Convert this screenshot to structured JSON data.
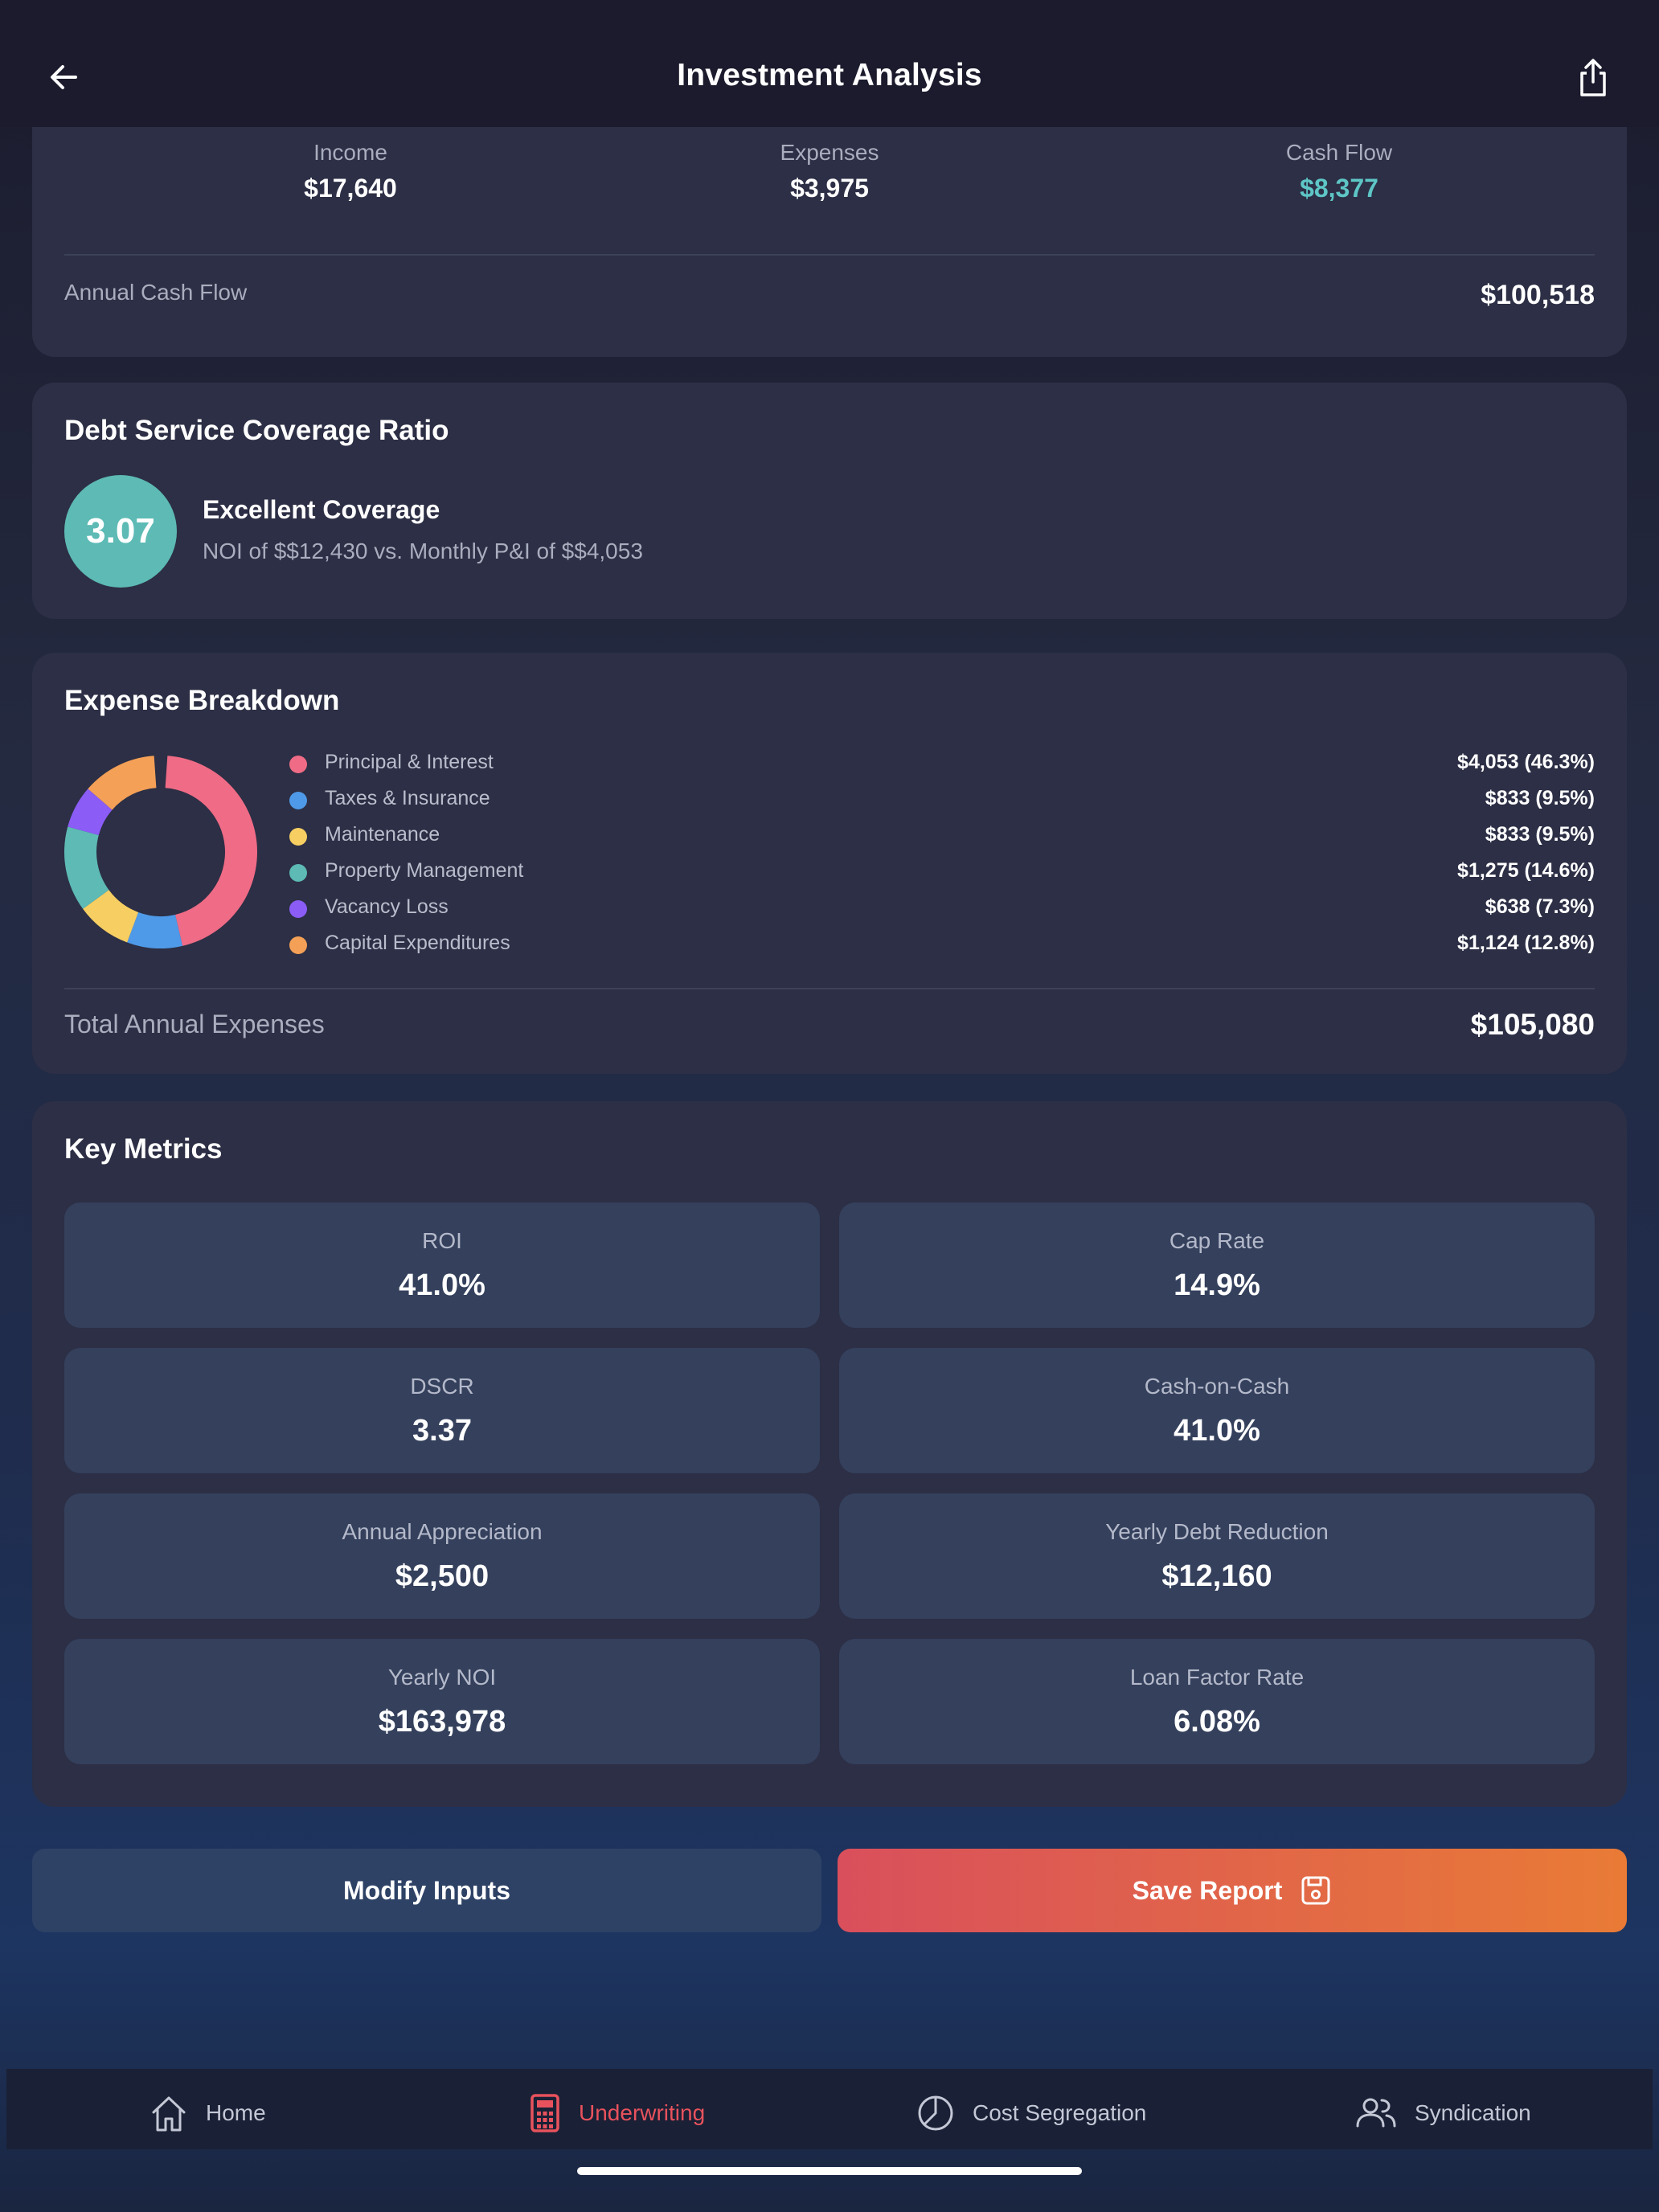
{
  "header": {
    "title": "Investment Analysis",
    "back_icon": "arrow-left-icon",
    "share_icon": "share-icon"
  },
  "monthly_summary": {
    "income_label": "Income",
    "income_value": "$17,640",
    "expenses_label": "Expenses",
    "expenses_value": "$3,975",
    "cashflow_label": "Cash Flow",
    "cashflow_value": "$8,377",
    "cashflow_color": "#5ec6c6",
    "annual_label": "Annual Cash Flow",
    "annual_value": "$100,518"
  },
  "dscr": {
    "title": "Debt Service Coverage Ratio",
    "value": "3.07",
    "status": "Excellent Coverage",
    "detail": "NOI of $$12,430 vs. Monthly P&I of $$4,053",
    "color": "#5dbab5"
  },
  "expense_breakdown": {
    "title": "Expense Breakdown",
    "total_label": "Total Annual Expenses",
    "total_value": "$105,080",
    "items": [
      {
        "label": "Principal & Interest",
        "value": "$4,053 (46.3%)",
        "color": "#f06b86"
      },
      {
        "label": "Taxes & Insurance",
        "value": "$833 (9.5%)",
        "color": "#4f9ae8"
      },
      {
        "label": "Maintenance",
        "value": "$833 (9.5%)",
        "color": "#f7ce62"
      },
      {
        "label": "Property Management",
        "value": "$1,275 (14.6%)",
        "color": "#5dbab5"
      },
      {
        "label": "Vacancy Loss",
        "value": "$638 (7.3%)",
        "color": "#8b5cf6"
      },
      {
        "label": "Capital Expenditures",
        "value": "$1,124 (12.8%)",
        "color": "#f4a056"
      }
    ]
  },
  "chart_data": {
    "type": "pie",
    "title": "Expense Breakdown",
    "categories": [
      "Principal & Interest",
      "Taxes & Insurance",
      "Maintenance",
      "Property Management",
      "Vacancy Loss",
      "Capital Expenditures"
    ],
    "values": [
      46.3,
      9.5,
      9.5,
      14.6,
      7.3,
      12.8
    ],
    "colors": [
      "#f06b86",
      "#4f9ae8",
      "#f7ce62",
      "#5dbab5",
      "#8b5cf6",
      "#f4a056"
    ]
  },
  "key_metrics": {
    "title": "Key Metrics",
    "tiles": [
      {
        "label": "ROI",
        "value": "41.0%"
      },
      {
        "label": "Cap Rate",
        "value": "14.9%"
      },
      {
        "label": "DSCR",
        "value": "3.37"
      },
      {
        "label": "Cash-on-Cash",
        "value": "41.0%"
      },
      {
        "label": "Annual Appreciation",
        "value": "$2,500"
      },
      {
        "label": "Yearly Debt Reduction",
        "value": "$12,160"
      },
      {
        "label": "Yearly NOI",
        "value": "$163,978"
      },
      {
        "label": "Loan Factor Rate",
        "value": "6.08%"
      }
    ]
  },
  "actions": {
    "modify_label": "Modify Inputs",
    "save_label": "Save Report",
    "save_icon": "floppy-disk-icon",
    "save_gradient": [
      "#d94f5c",
      "#e97b36"
    ]
  },
  "tabbar": {
    "active_color": "#e8525d",
    "tabs": [
      {
        "label": "Home",
        "icon": "home-icon",
        "active": false
      },
      {
        "label": "Underwriting",
        "icon": "calculator-icon",
        "active": true
      },
      {
        "label": "Cost Segregation",
        "icon": "pie-chart-icon",
        "active": false
      },
      {
        "label": "Syndication",
        "icon": "users-icon",
        "active": false
      }
    ]
  }
}
